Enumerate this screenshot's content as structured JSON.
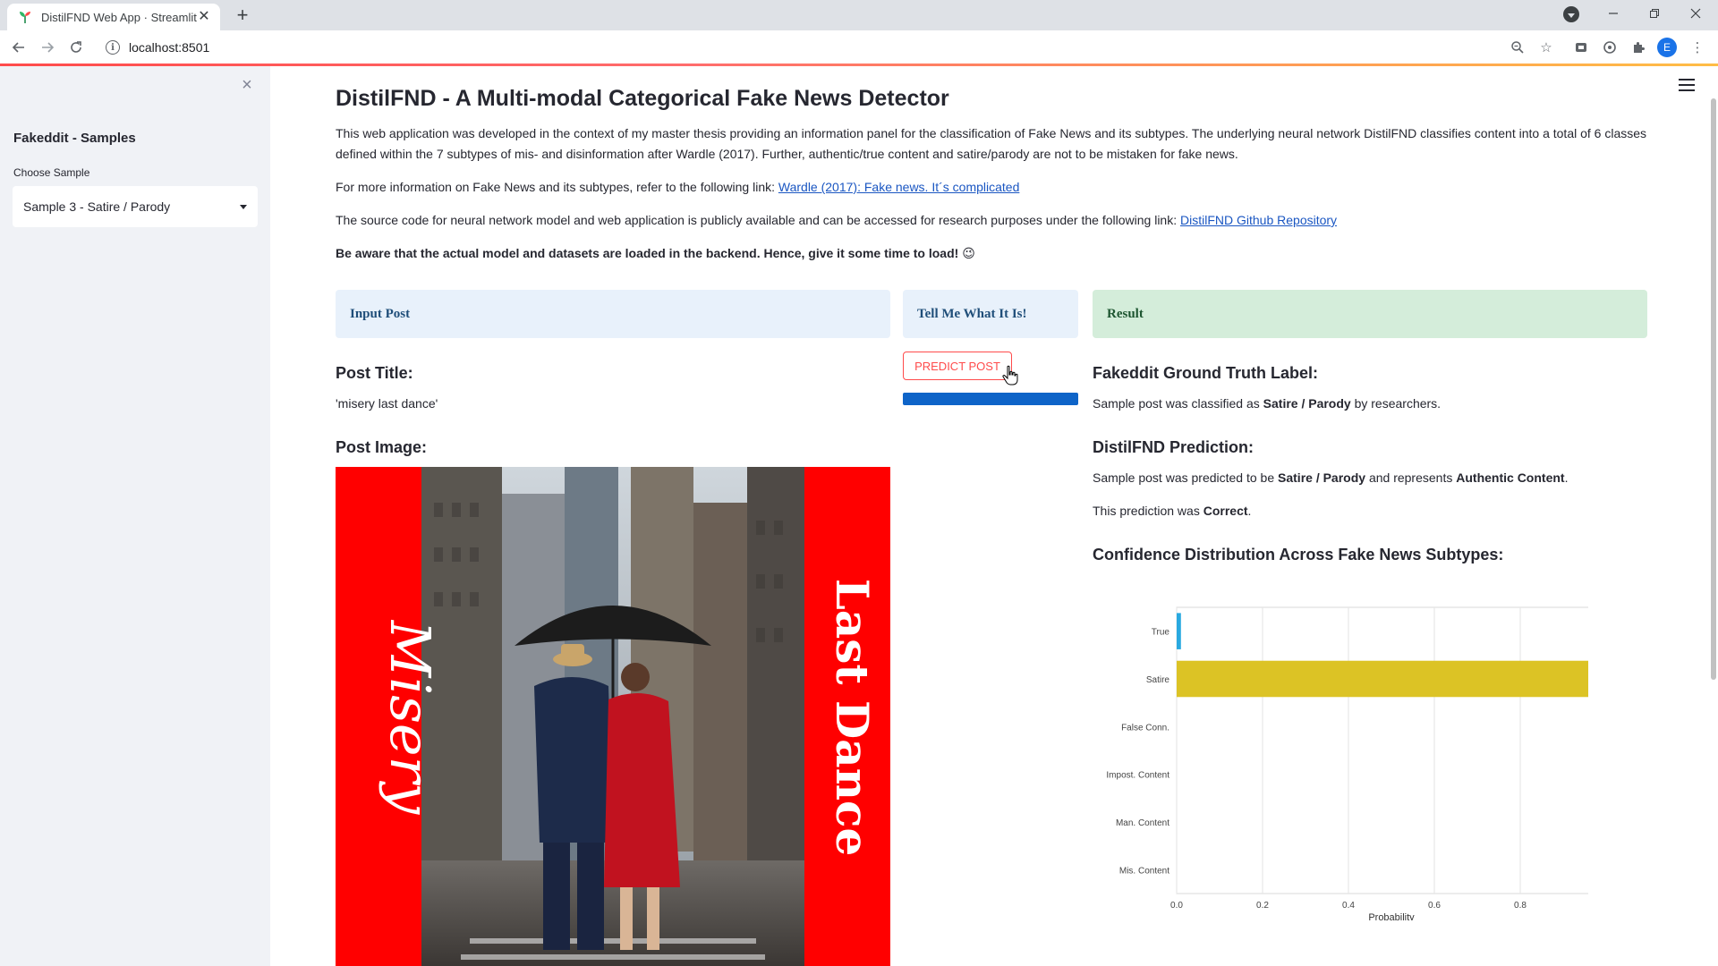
{
  "browser": {
    "tab_title": "DistilFND Web App · Streamlit",
    "url": "localhost:8501",
    "profile_initial": "E"
  },
  "sidebar": {
    "title": "Fakeddit - Samples",
    "select_label": "Choose Sample",
    "selected_sample": "Sample 3 - Satire / Parody"
  },
  "main": {
    "title": "DistilFND - A Multi-modal Categorical Fake News Detector",
    "intro": "This web application was developed in the context of my master thesis providing an information panel for the classification of Fake News and its subtypes. The underlying neural network DistilFND classifies content into a total of 6 classes defined within the 7 subtypes of mis- and disinformation after Wardle (2017). Further, authentic/true content and satire/parody are not to be mistaken for fake news.",
    "more_info_text": "For more information on Fake News and its subtypes, refer to the following link:",
    "more_info_link": "Wardle (2017): Fake news. It´s complicated",
    "source_text": "The source code for neural network model and web application is publicly available and can be accessed for research purposes under the following link:",
    "source_link": "DistilFND Github Repository",
    "warning": "Be aware that the actual model and datasets are loaded in the backend. Hence, give it some time to load!",
    "warning_emoji": "😉"
  },
  "panels": {
    "input": "Input Post",
    "action": "Tell Me What It Is!",
    "result": "Result"
  },
  "input_post": {
    "title_heading": "Post Title:",
    "title_value": "'misery last dance'",
    "image_heading": "Post Image:",
    "image_left_text": "Misery",
    "image_right_text": "Last Dance"
  },
  "action": {
    "predict_label": "PREDICT POST",
    "progress": 1.0
  },
  "result": {
    "ground_truth_heading": "Fakeddit Ground Truth Label:",
    "gt_pre": "Sample post was classified as",
    "gt_label": "Satire / Parody",
    "gt_post": "by researchers.",
    "prediction_heading": "DistilFND Prediction:",
    "pred_pre": "Sample post was predicted to be",
    "pred_label": "Satire / Parody",
    "pred_mid": "and represents",
    "pred_class": "Authentic Content",
    "pred_end": ".",
    "correct_pre": "This prediction was",
    "correct_value": "Correct",
    "correct_end": ".",
    "chart_heading": "Confidence Distribution Across Fake News Subtypes:"
  },
  "colors": {
    "accent": "#ff4b4b",
    "progress": "#0e64c8",
    "true_bar": "#29a9e0",
    "satire_bar": "#dcc325"
  },
  "chart_data": {
    "type": "bar",
    "orientation": "horizontal",
    "categories": [
      "True",
      "Satire",
      "False Conn.",
      "Impost. Content",
      "Man. Content",
      "Mis. Content"
    ],
    "values": [
      0.01,
      0.98,
      0.0,
      0.0,
      0.0,
      0.0
    ],
    "xlabel": "Probability",
    "ylabel": "",
    "xlim": [
      0,
      1.0
    ],
    "xticks": [
      "0.0",
      "0.2",
      "0.4",
      "0.6",
      "0.8",
      "1.0"
    ],
    "grid": true
  }
}
